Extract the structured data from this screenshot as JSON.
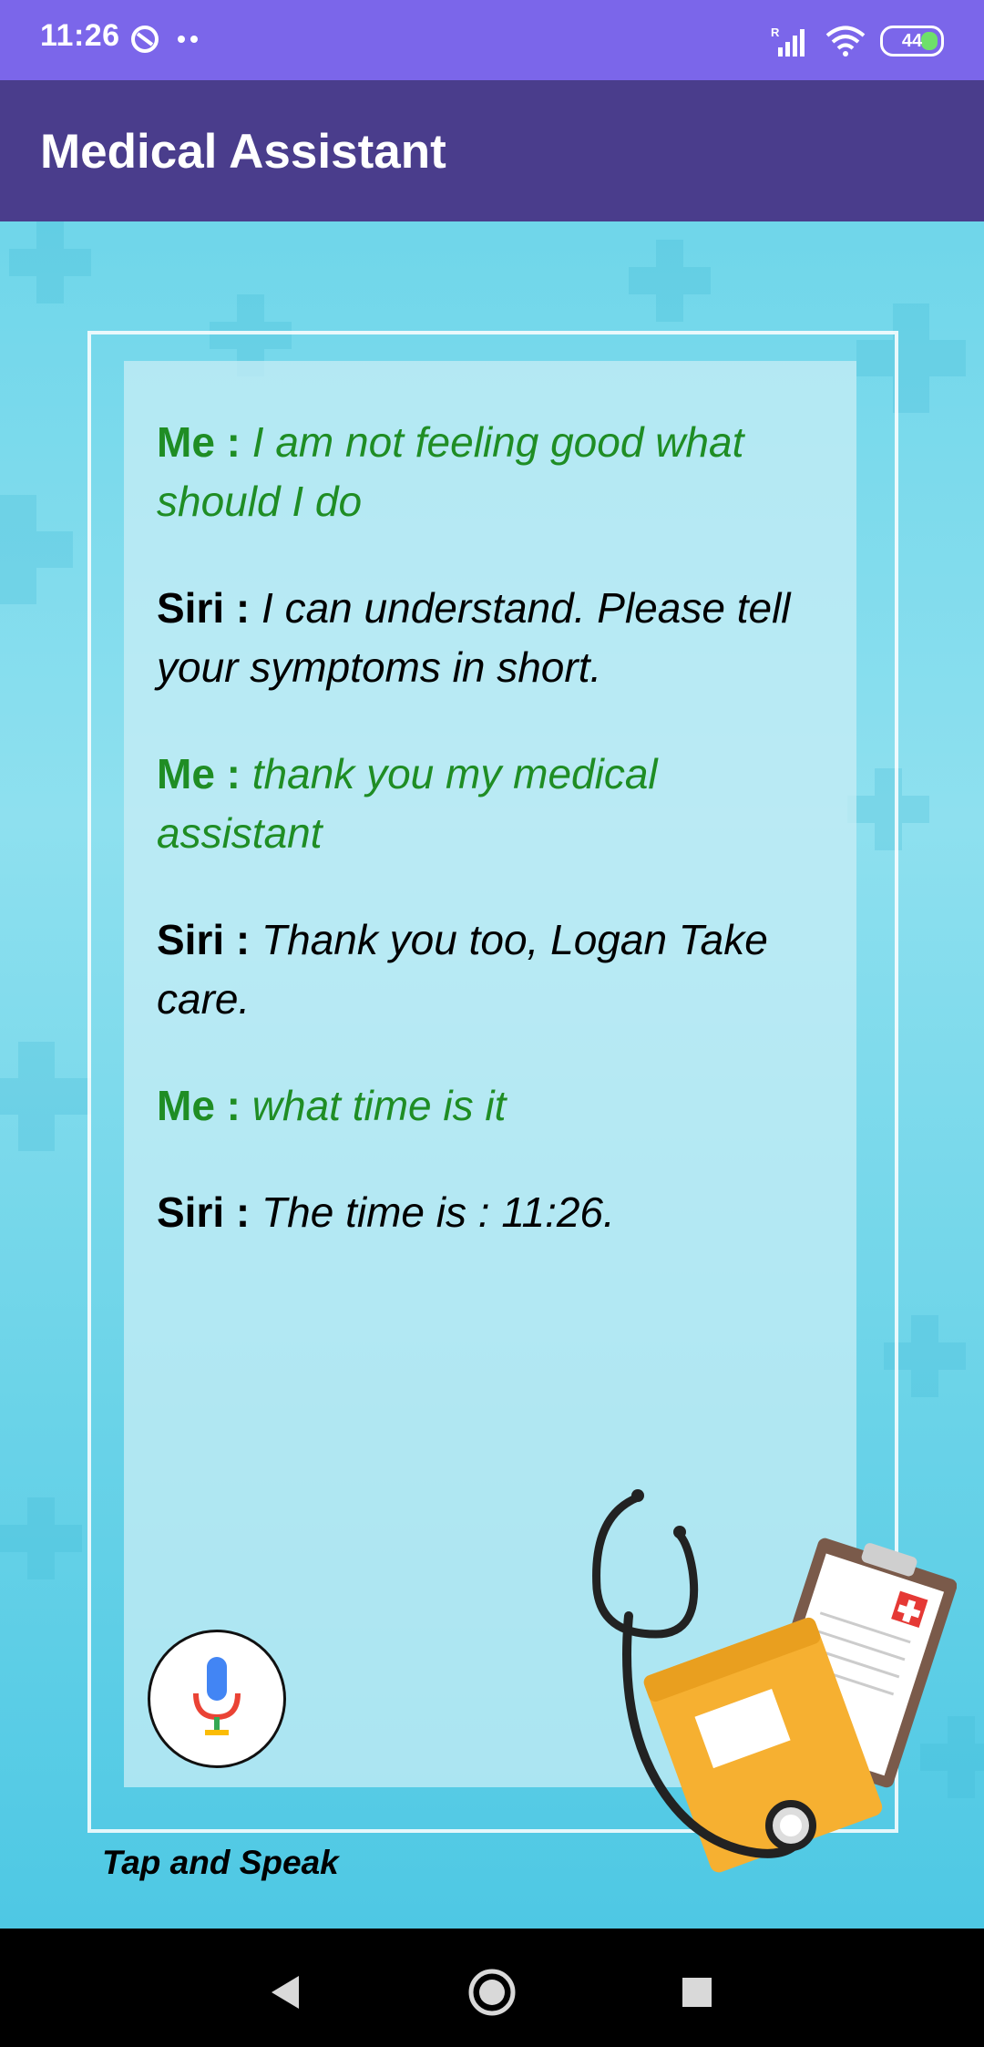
{
  "status_bar": {
    "time": "11:26",
    "battery": "44",
    "network_label": "R"
  },
  "app_bar": {
    "title": "Medical Assistant"
  },
  "conversation": [
    {
      "speaker": "Me :",
      "text": "I am not feeling good what should I do",
      "role": "me"
    },
    {
      "speaker": "Siri :",
      "text": "I can understand. Please tell your symptoms in short.",
      "role": "siri"
    },
    {
      "speaker": "Me :",
      "text": "thank you my medical assistant",
      "role": "me"
    },
    {
      "speaker": "Siri :",
      "text": "Thank you too, Logan Take care.",
      "role": "siri"
    },
    {
      "speaker": "Me :",
      "text": "what time is it",
      "role": "me"
    },
    {
      "speaker": "Siri :",
      "text": "The time is : 11:26.",
      "role": "siri"
    }
  ],
  "mic": {
    "label": "Tap and Speak",
    "icon": "microphone-icon"
  },
  "colors": {
    "status_bar": "#7b66ea",
    "app_bar": "#4a3d8c",
    "me_text": "#1f8d24",
    "siri_text": "#000000",
    "background": "#6fd6ea"
  },
  "nav": {
    "back_icon": "back-triangle-icon",
    "home_icon": "home-circle-icon",
    "recents_icon": "recents-square-icon"
  }
}
